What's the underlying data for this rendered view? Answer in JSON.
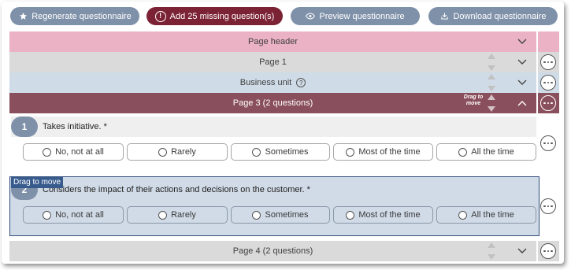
{
  "toolbar": {
    "regenerate": {
      "label": "Regenerate questionnaire",
      "icon": "star-icon"
    },
    "add_missing": {
      "label": "Add 25 missing question(s)",
      "icon": "exclamation-circle-icon"
    },
    "preview": {
      "label": "Preview questionnaire",
      "icon": "eye-icon"
    },
    "download": {
      "label": "Download questionnaire",
      "icon": "download-icon"
    }
  },
  "sections": {
    "page_header": {
      "label": "Page header"
    },
    "page1": {
      "label": "Page 1"
    },
    "business_unit": {
      "label": "Business unit",
      "help_icon": "?"
    },
    "page3": {
      "label": "Page 3 (2 questions)",
      "drag_hint": "Drag to move"
    },
    "page4": {
      "label": "Page 4 (2 questions)"
    }
  },
  "questions": [
    {
      "number": "1",
      "text": "Takes initiative. *",
      "options": [
        "No, not at all",
        "Rarely",
        "Sometimes",
        "Most of the time",
        "All the time"
      ]
    },
    {
      "number": "2",
      "text": "Considers the impact of their actions and decisions on the customer. *",
      "drag_tag": "Drag to move",
      "options": [
        "No, not at all",
        "Rarely",
        "Sometimes",
        "Most of the time",
        "All the time"
      ]
    }
  ],
  "colors": {
    "header_pink": "#eab2c4",
    "page_grey": "#dadada",
    "business_blue": "#cfdbe7",
    "page3_maroon": "#8a4f5c",
    "button_blue": "#7f91a9",
    "button_primary": "#7b2334"
  }
}
